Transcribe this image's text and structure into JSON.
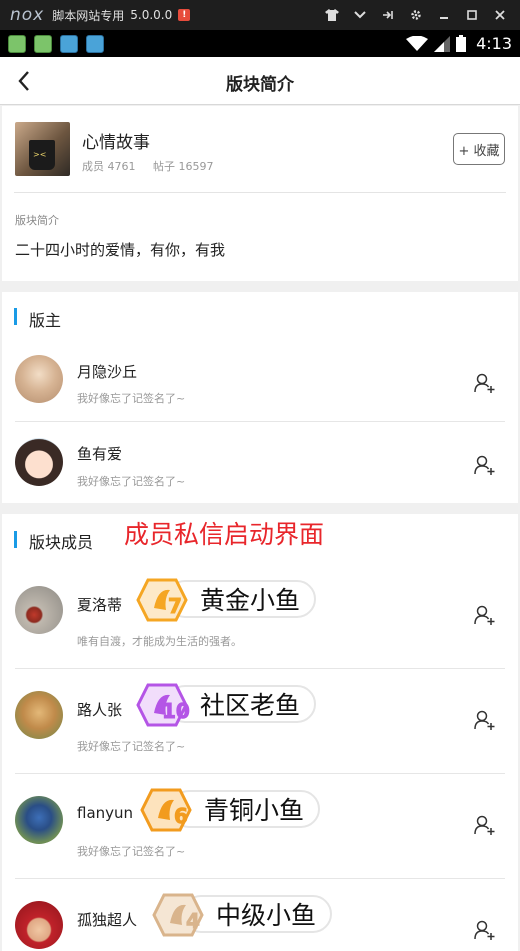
{
  "emulator": {
    "logo": "nox",
    "title": "脚本网站专用",
    "version": "5.0.0.0",
    "alert": "!"
  },
  "status_bar": {
    "time": "4:13"
  },
  "header": {
    "title": "版块简介",
    "back_icon": "back-arrow-icon"
  },
  "forum": {
    "name": "心情故事",
    "members_label": "成员 4761",
    "posts_label": "帖子 16597",
    "favorite_label": "+ 收藏",
    "intro_label": "版块简介",
    "intro_text": "二十四小时的爱情，有你，有我"
  },
  "moderators": {
    "title": "版主",
    "items": [
      {
        "name": "月隐沙丘",
        "signature": "我好像忘了记签名了~"
      },
      {
        "name": "鱼有爱",
        "signature": "我好像忘了记签名了~"
      }
    ]
  },
  "annotation": "成员私信启动界面",
  "members": {
    "title": "版块成员",
    "items": [
      {
        "name": "夏洛蒂",
        "signature": "唯有自渡，才能成为生活的强者。",
        "badge_level": "7",
        "badge_title": "黄金小鱼",
        "badge_color": "#f5a623"
      },
      {
        "name": "路人张",
        "signature": "我好像忘了记签名了~",
        "badge_level": "10",
        "badge_title": "社区老鱼",
        "badge_color": "#b455e6"
      },
      {
        "name": "flanyun",
        "signature": "我好像忘了记签名了~",
        "badge_level": "6",
        "badge_title": "青铜小鱼",
        "badge_color": "#f29b1e"
      },
      {
        "name": "孤独超人",
        "signature": "",
        "badge_level": "4",
        "badge_title": "中级小鱼",
        "badge_color": "#d9b48c"
      }
    ]
  },
  "colors": {
    "accent": "#1a9be6",
    "annotation": "#e8262b"
  }
}
